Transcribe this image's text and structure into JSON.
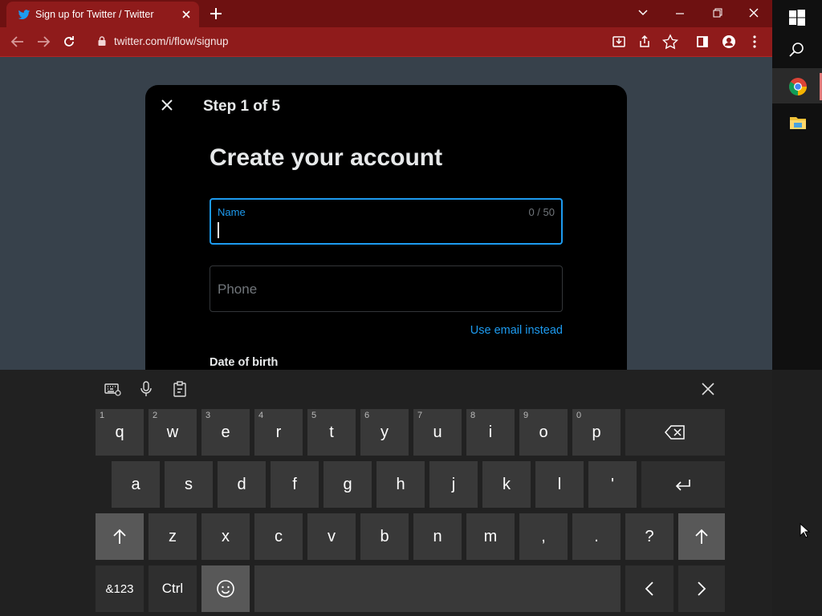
{
  "browser": {
    "tab_title": "Sign up for Twitter / Twitter",
    "url": "twitter.com/i/flow/signup"
  },
  "modal": {
    "step": "Step 1 of 5",
    "heading": "Create your account",
    "name_label": "Name",
    "name_count": "0 / 50",
    "phone_placeholder": "Phone",
    "email_link": "Use email instead",
    "dob_label": "Date of birth"
  },
  "keyboard": {
    "row1": [
      {
        "k": "q",
        "n": "1"
      },
      {
        "k": "w",
        "n": "2"
      },
      {
        "k": "e",
        "n": "3"
      },
      {
        "k": "r",
        "n": "4"
      },
      {
        "k": "t",
        "n": "5"
      },
      {
        "k": "y",
        "n": "6"
      },
      {
        "k": "u",
        "n": "7"
      },
      {
        "k": "i",
        "n": "8"
      },
      {
        "k": "o",
        "n": "9"
      },
      {
        "k": "p",
        "n": "0"
      }
    ],
    "row2": [
      "a",
      "s",
      "d",
      "f",
      "g",
      "h",
      "j",
      "k",
      "l",
      "'"
    ],
    "row3": [
      "z",
      "x",
      "c",
      "v",
      "b",
      "n",
      "m",
      ",",
      ".",
      "?"
    ],
    "sym_label": "&123",
    "ctrl_label": "Ctrl"
  },
  "colors": {
    "chrome_red": "#8f1b1b",
    "twitter_blue": "#1d9bf0",
    "page_bg": "#37414b"
  }
}
